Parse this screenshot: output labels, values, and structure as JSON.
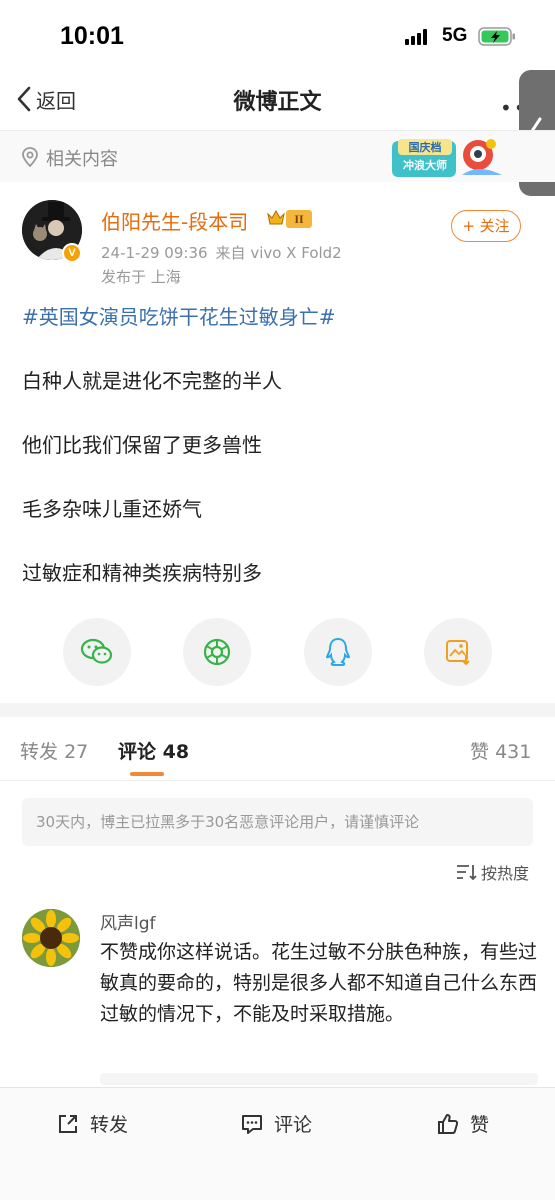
{
  "status_bar": {
    "time": "10:01",
    "network": "5G"
  },
  "nav": {
    "back_label": "返回",
    "title": "微博正文"
  },
  "related": {
    "label": "相关内容",
    "promo_line1": "国庆档",
    "promo_line2": "冲浪大师"
  },
  "author": {
    "name": "伯阳先生-段本司",
    "level": "II",
    "verified": "V",
    "date": "24-1-29 09:36",
    "source": "来自 vivo X Fold2",
    "location": "发布于 上海",
    "follow_label": "+ 关注"
  },
  "post": {
    "hashtag": "#英国女演员吃饼干花生过敏身亡#",
    "lines": [
      "白种人就是进化不完整的半人",
      "他们比我们保留了更多兽性",
      "毛多杂味儿重还娇气",
      "过敏症和精神类疾病特别多"
    ]
  },
  "share": [
    "wechat-icon",
    "moments-icon",
    "qq-icon",
    "save-image-icon"
  ],
  "tabs": {
    "repost_label": "转发",
    "repost_count": "27",
    "comment_label": "评论",
    "comment_count": "48",
    "like_label": "赞",
    "like_count": "431"
  },
  "notice": "30天内，博主已拉黑多于30名恶意评论用户，请谨慎评论",
  "sort_label": "按热度",
  "comment": {
    "name": "风声lgf",
    "text": "不赞成你这样说话。花生过敏不分肤色种族，有些过敏真的要命的，特别是很多人都不知道自己什么东西过敏的情况下，不能及时采取措施。"
  },
  "bottom_bar": {
    "repost": "转发",
    "comment": "评论",
    "like": "赞"
  },
  "colors": {
    "accent": "#f08a3a",
    "author_name": "#e86b0c",
    "hashtag": "#3a6fb0"
  }
}
